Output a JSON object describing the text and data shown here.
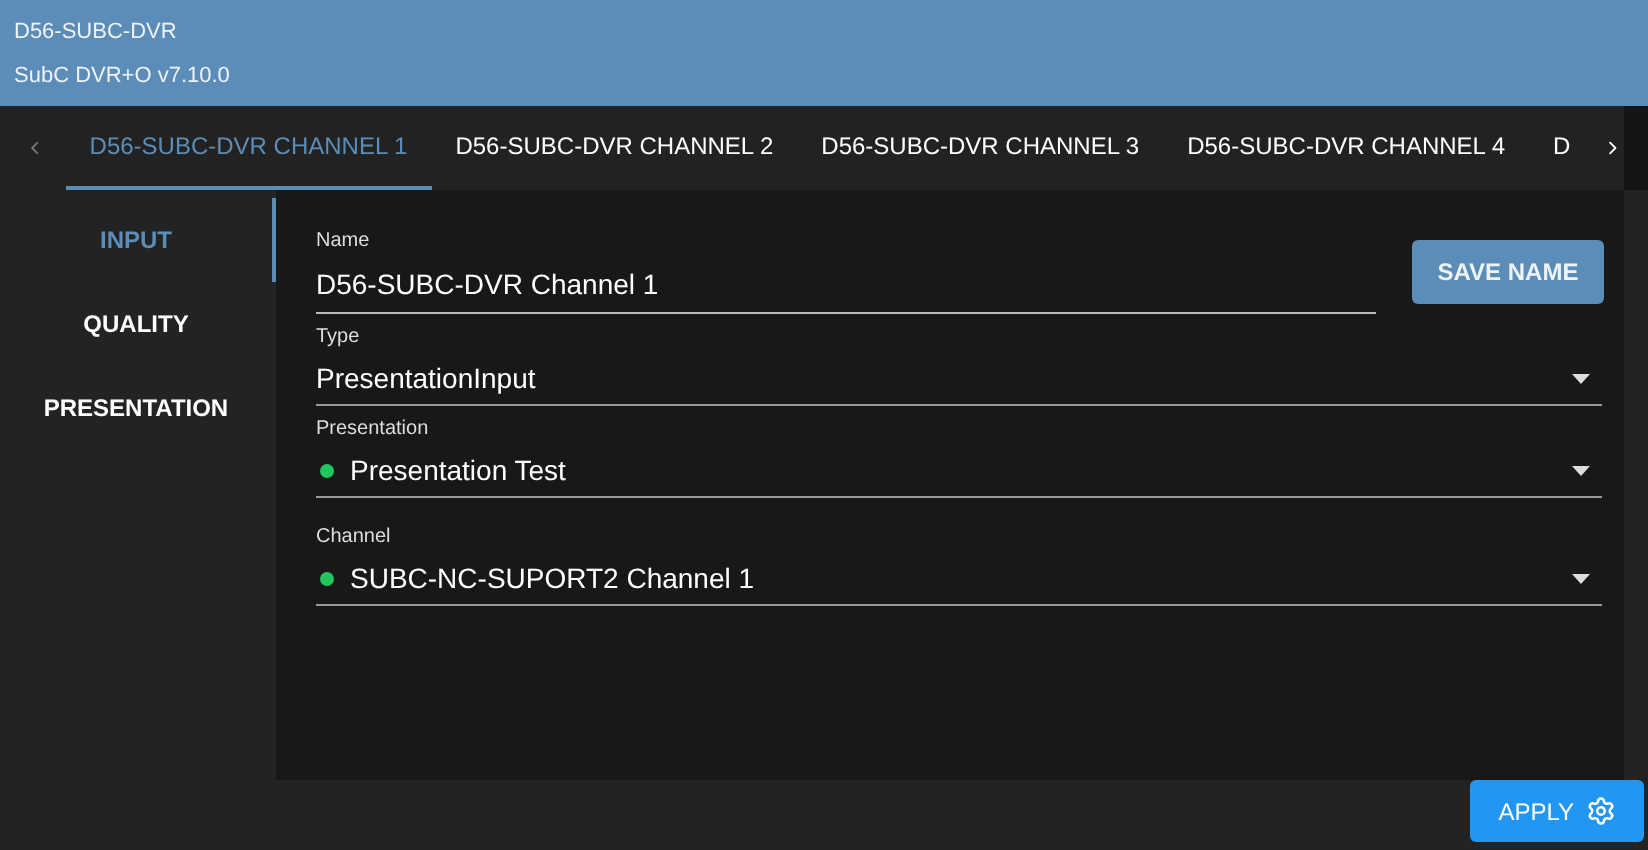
{
  "header": {
    "title": "D56-SUBC-DVR",
    "subtitle": "SubC DVR+O v7.10.0"
  },
  "tabs": [
    {
      "label": "D56-SUBC-DVR CHANNEL 1",
      "selected": true
    },
    {
      "label": "D56-SUBC-DVR CHANNEL 2",
      "selected": false
    },
    {
      "label": "D56-SUBC-DVR CHANNEL 3",
      "selected": false
    },
    {
      "label": "D56-SUBC-DVR CHANNEL 4",
      "selected": false
    },
    {
      "label": "D",
      "selected": false
    }
  ],
  "sidebar": {
    "items": [
      {
        "label": "INPUT",
        "selected": true
      },
      {
        "label": "QUALITY",
        "selected": false
      },
      {
        "label": "PRESENTATION",
        "selected": false
      }
    ]
  },
  "fields": [
    {
      "kind": "text",
      "label": "Name",
      "value": "D56-SUBC-DVR Channel 1",
      "button": "SAVE NAME"
    },
    {
      "kind": "select",
      "label": "Type",
      "value": "PresentationInput"
    },
    {
      "kind": "select",
      "label": "Presentation",
      "value": "Presentation Test",
      "color": "#22c55e"
    },
    {
      "kind": "select",
      "label": "Channel",
      "value": "SUBC-NC-SUPORT2 Channel 1",
      "color": "#22c55e"
    }
  ],
  "apply_button": "APPLY"
}
